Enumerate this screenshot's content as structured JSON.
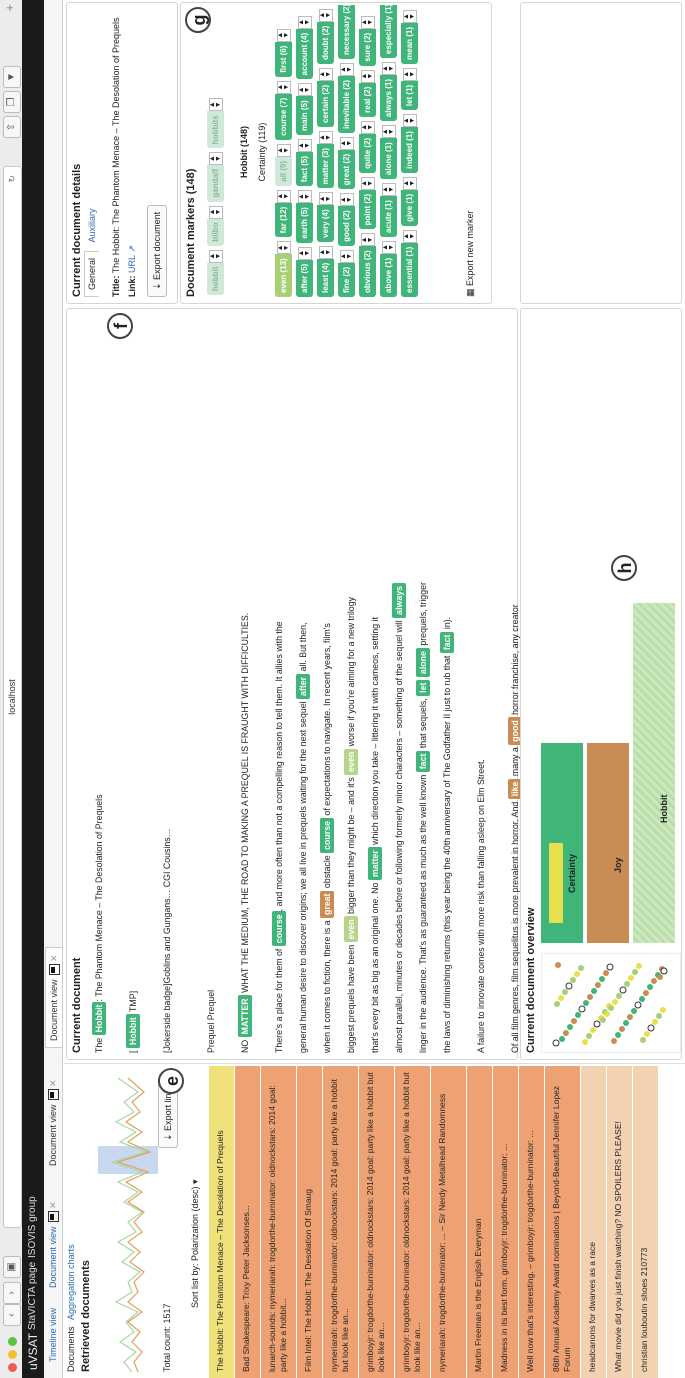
{
  "browser": {
    "url": "localhost",
    "tab_bar": [
      "uVSAT",
      "StaVICTA page",
      "ISOVIS group"
    ]
  },
  "view_tabs": [
    {
      "label": "Timeline view"
    },
    {
      "label": "Document view"
    },
    {
      "label": "Document view"
    },
    {
      "label": "Document view"
    }
  ],
  "left": {
    "subnav": [
      "Documents",
      "Aggregation charts"
    ],
    "title": "Retrieved documents",
    "total_count": "Total count: 1517",
    "export_links": "Export links",
    "sort_label": "Sort list by: Polarization (desc)",
    "marker_e": "e",
    "documents": [
      {
        "text": "The Hobbit: The Phantom Menace – The Desolation of Prequels",
        "color": "#f0e27a"
      },
      {
        "text": "Bad Shakespeare: Trixy Peter Jacksonses...",
        "color": "#eea274"
      },
      {
        "text": "lunarch-sounds: nymeriarah: trogdorthe-burninator: oldnockstars: 2014 goal: party like a hobbit...",
        "color": "#eea274"
      },
      {
        "text": "Film Intel: The Hobbit: The Desolation Of Smaug",
        "color": "#eea274"
      },
      {
        "text": "nymeriarah: trogdorthe-burninator: oldnockstars: 2014 goal: party like a hobbit but look like an...",
        "color": "#eea274"
      },
      {
        "text": "grimboyjr: trogdorthe-burninator: oldnockstars: 2014 goal: party like a hobbit but look like an...",
        "color": "#eea274"
      },
      {
        "text": "grimboyjr: trogdorthe-burninator: oldnockstars: 2014 goal: party like a hobbit but look like an...",
        "color": "#eea274"
      },
      {
        "text": "nymeriarah: trogdorthe-burninator: ... – Sir Nerdy Metalhead Randomness",
        "color": "#eea274"
      },
      {
        "text": "Martin Freeman is the English Everyman",
        "color": "#eea274"
      },
      {
        "text": "Madness in its best form. grimboyjr: trogdorthe-burninator: ...",
        "color": "#eea274"
      },
      {
        "text": "Well now that's interesting. – grimboyjr: trogdorthe-burninator: ...",
        "color": "#eea274"
      },
      {
        "text": "86th Annual Academy Award nominations | Beyond-Beautiful Jennifer Lopez Forum",
        "color": "#eea274"
      },
      {
        "text": "headcanons for dwarves as a race",
        "color": "#f3d2b2"
      },
      {
        "text": "What movie did you just finish watching? NO SPOILERS PLEASE!",
        "color": "#f3d2b2"
      },
      {
        "text": "christian louboutin shoes 210773",
        "color": "#f3d2b2"
      }
    ]
  },
  "doc": {
    "title": "Current document",
    "marker_f": "f",
    "line1_pre": "The",
    "line1_tag": "Hobbit",
    "line1_post": ": The Phantom Menace – The Desolation of Prequels",
    "line2_tag": "Hobbit",
    "line2_post": "TMP]",
    "line3": "[Jokerside badge]Goblins and Gungans… CGI Cousins…",
    "line4": "Prequel Prequel",
    "heading_pre": "NO",
    "heading_tag": "MATTER",
    "heading_post": "WHAT THE MEDIUM, THE ROAD TO MAKING A PREQUEL IS FRAUGHT WITH DIFFICULTIES.",
    "p1": [
      {
        "t": "There's a place for them of "
      },
      {
        "h": "course",
        "c": "g"
      },
      {
        "t": ", and more often than not a compelling reason to tell them.  It allies with the "
      },
      {
        "br": 1
      },
      {
        "t": "general human desire to discover origins; we all live in prequels waiting for the next sequel "
      },
      {
        "h": "after",
        "c": "g"
      },
      {
        "t": " all.  But then,"
      },
      {
        "br": 1
      },
      {
        "t": "when it comes to fiction, there is a "
      },
      {
        "h": "great",
        "c": "o"
      },
      {
        "t": " obstacle "
      },
      {
        "h": "course",
        "c": "g"
      },
      {
        "t": " of expectations to navigate.  In recent years, film's"
      },
      {
        "br": 1
      },
      {
        "t": "biggest prequels have been "
      },
      {
        "h": "even",
        "c": "lg"
      },
      {
        "t": " bigger than they might be – and it's "
      },
      {
        "h": "even",
        "c": "lg"
      },
      {
        "t": " worse if you're aiming for a new trilogy"
      },
      {
        "br": 1
      },
      {
        "t": "that's every bit as big as an original one.  No "
      },
      {
        "h": "matter",
        "c": "g"
      },
      {
        "t": " which direction you take – littering it with cameos, setting it"
      },
      {
        "br": 1
      },
      {
        "t": "almost parallel, minutes or decades before or following formerly minor characters – something of the sequel will "
      },
      {
        "h": "always",
        "c": "g"
      },
      {
        "br": 1
      },
      {
        "t": "linger in the audience.  That's as guaranteed as much as the well known "
      },
      {
        "h": "fact",
        "c": "g"
      },
      {
        "t": " that sequels, "
      },
      {
        "h": "let",
        "c": "g"
      },
      {
        "t": " "
      },
      {
        "h": "alone",
        "c": "g"
      },
      {
        "t": " prequels, trigger"
      },
      {
        "br": 1
      },
      {
        "t": "the laws of diminishing returns (this year being the 40th anniversary of The Godfather II just to rub that "
      },
      {
        "h": "fact",
        "c": "g"
      },
      {
        "t": " in)."
      }
    ],
    "p2": "A failure to innovate comes with more risk than falling asleep on Elm Street.",
    "p3": [
      {
        "t": "Of all film genres, film sequelitus is more prevalent in horror.  And "
      },
      {
        "h": "like",
        "c": "o"
      },
      {
        "t": " many a "
      },
      {
        "h": "good",
        "c": "o"
      },
      {
        "t": " horror franchise, any creator"
      },
      {
        "br": 1
      },
      {
        "t": "looking to create a prequel may want to serve up exactly the same thing that flooded the box office last time round."
      }
    ]
  },
  "overview": {
    "title": "Current document overview",
    "marker_h": "h",
    "bars": [
      "Certainty",
      "Joy",
      "Hobbit"
    ]
  },
  "details": {
    "title": "Current document details",
    "tabs": [
      "General",
      "Auxiliary"
    ],
    "doc_title_label": "Title:",
    "doc_title": "The Hobbit: The Phantom Menace – The Desolation of Prequels",
    "link_label": "Link:",
    "link_text": "URL",
    "export_doc": "Export document"
  },
  "markers": {
    "title": "Document markers (148)",
    "marker_g": "g",
    "hobbit_header": "Hobbit (148)",
    "hobbit": [
      "hobbit",
      "bilbo",
      "gandalf",
      "hobbits"
    ],
    "certainty_header": "Certainty (119)",
    "rows": [
      [
        {
          "l": "even (13)",
          "s": "lg"
        },
        {
          "l": "far (12)"
        },
        {
          "l": "all (9)",
          "s": "faint"
        },
        {
          "l": "course (7)"
        },
        {
          "l": "first (6)"
        }
      ],
      [
        {
          "l": "after (5)"
        },
        {
          "l": "earth (5)"
        },
        {
          "l": "fact (5)"
        },
        {
          "l": "main (5)"
        },
        {
          "l": "account (4)"
        }
      ],
      [
        {
          "l": "least (4)"
        },
        {
          "l": "very (4)"
        },
        {
          "l": "matter (3)"
        },
        {
          "l": "certain (2)"
        },
        {
          "l": "doubt (2)"
        }
      ],
      [
        {
          "l": "fine (2)"
        },
        {
          "l": "good (2)"
        },
        {
          "l": "great (2)"
        },
        {
          "l": "inevitable (2)"
        },
        {
          "l": "necessary (2)"
        }
      ],
      [
        {
          "l": "obvious (2)"
        },
        {
          "l": "point (2)"
        },
        {
          "l": "quite (2)"
        },
        {
          "l": "real (2)"
        },
        {
          "l": "sure (2)"
        }
      ],
      [
        {
          "l": "above (1)"
        },
        {
          "l": "acute (1)"
        },
        {
          "l": "alone (1)"
        },
        {
          "l": "always (1)"
        },
        {
          "l": "especially (1)"
        }
      ],
      [
        {
          "l": "essential (1)"
        },
        {
          "l": "give (1)"
        },
        {
          "l": "indeed (1)"
        },
        {
          "l": "let (1)"
        },
        {
          "l": "mean (1)"
        }
      ]
    ],
    "export_marker": "Export new marker"
  }
}
